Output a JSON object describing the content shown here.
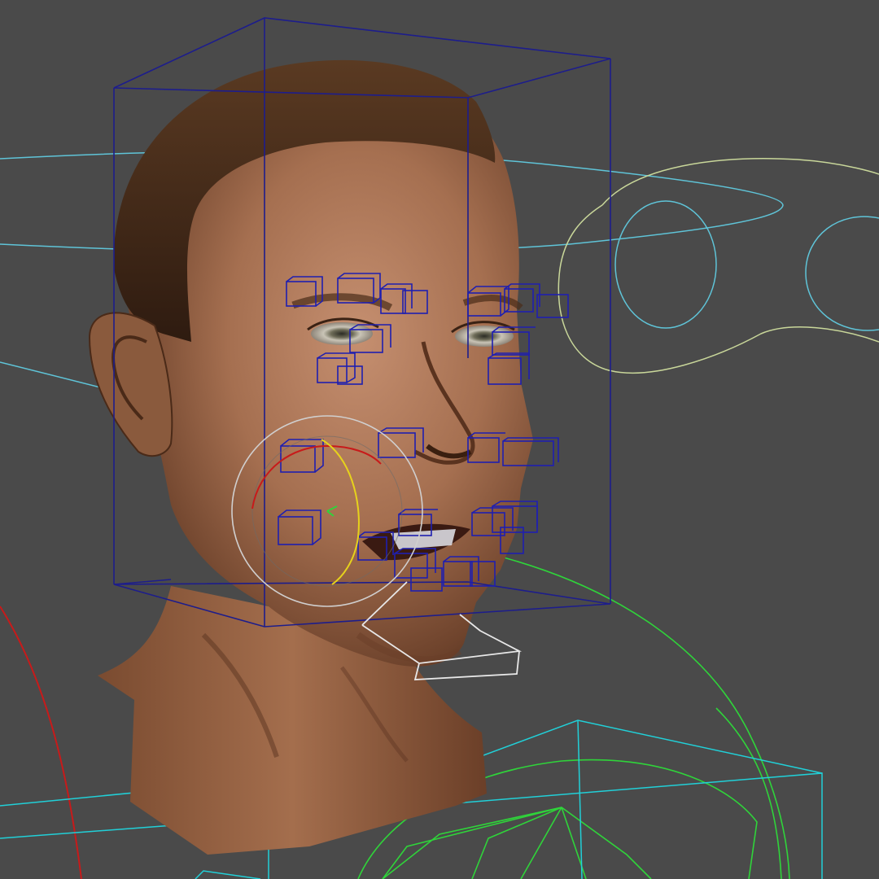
{
  "viewport": {
    "background": "#4a4a4a",
    "content": "3d-head-model-with-facial-rig"
  },
  "colors": {
    "bounding_box": "#1d1d8c",
    "facial_controls": "#1f1fb0",
    "spline_cyan": "#5fc4d8",
    "eye_curve": "#c9d79a",
    "green_rig": "#2fd43a",
    "red_axis": "#c81a1a",
    "yellow_axis": "#e6d21c",
    "gizmo_white": "#d9d9d9",
    "grid_cyan": "#21d0d8",
    "skin": "#a06a4a"
  },
  "icons": [
    "rotate-gizmo-icon"
  ]
}
